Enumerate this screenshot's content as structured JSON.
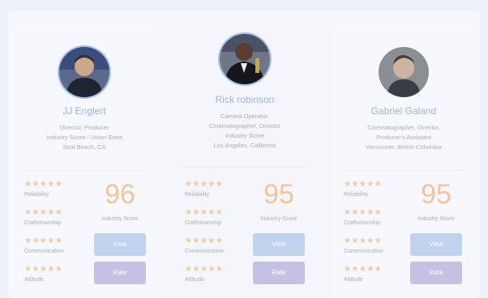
{
  "colors": {
    "background": "#eef1f8",
    "name": "#9bb5e4",
    "stars": "#f2c89c",
    "score": "#f4c49a",
    "view_button": "#bfd2ee",
    "rate_button": "#c6c0e4"
  },
  "cards": [
    {
      "name": "JJ Englert",
      "description": [
        "Director, Producer",
        "Industry Score / Union Extra",
        "Seal Beach, CA"
      ],
      "ratings": [
        {
          "stars": "★★★★★",
          "label": "Reliability"
        },
        {
          "stars": "★★★★★",
          "label": "Craftsmanship"
        },
        {
          "stars": "★★★★★",
          "label": "Communication"
        },
        {
          "stars": "★★★★★",
          "label": "Attitude"
        }
      ],
      "score": "96",
      "score_label": "Industry Score",
      "view_label": "View",
      "rate_label": "Rate"
    },
    {
      "name": "Rick robinson",
      "description": [
        "Camera Operator,",
        "Cinematographer, Director",
        "Industry Score",
        "Los Angeles, California"
      ],
      "ratings": [
        {
          "stars": "★★★★★",
          "label": "Reliability"
        },
        {
          "stars": "★★★★★",
          "label": "Craftsmanship"
        },
        {
          "stars": "★★★★★",
          "label": "Communication"
        },
        {
          "stars": "★★★★★",
          "label": "Attitude"
        }
      ],
      "score": "95",
      "score_label": "Industry Score",
      "view_label": "View",
      "rate_label": "Rate"
    },
    {
      "name": "Gabriel Galand",
      "description": [
        "Cinematographer, Director,",
        "Producer's Assistant",
        "Vancouver, British Columbia"
      ],
      "ratings": [
        {
          "stars": "★★★★★",
          "label": "Reliability"
        },
        {
          "stars": "★★★★★",
          "label": "Craftsmanship"
        },
        {
          "stars": "★★★★★",
          "label": "Communication"
        },
        {
          "stars": "★★★★★",
          "label": "Attitude"
        }
      ],
      "score": "95",
      "score_label": "Industry Score",
      "view_label": "View",
      "rate_label": "Rate"
    }
  ]
}
